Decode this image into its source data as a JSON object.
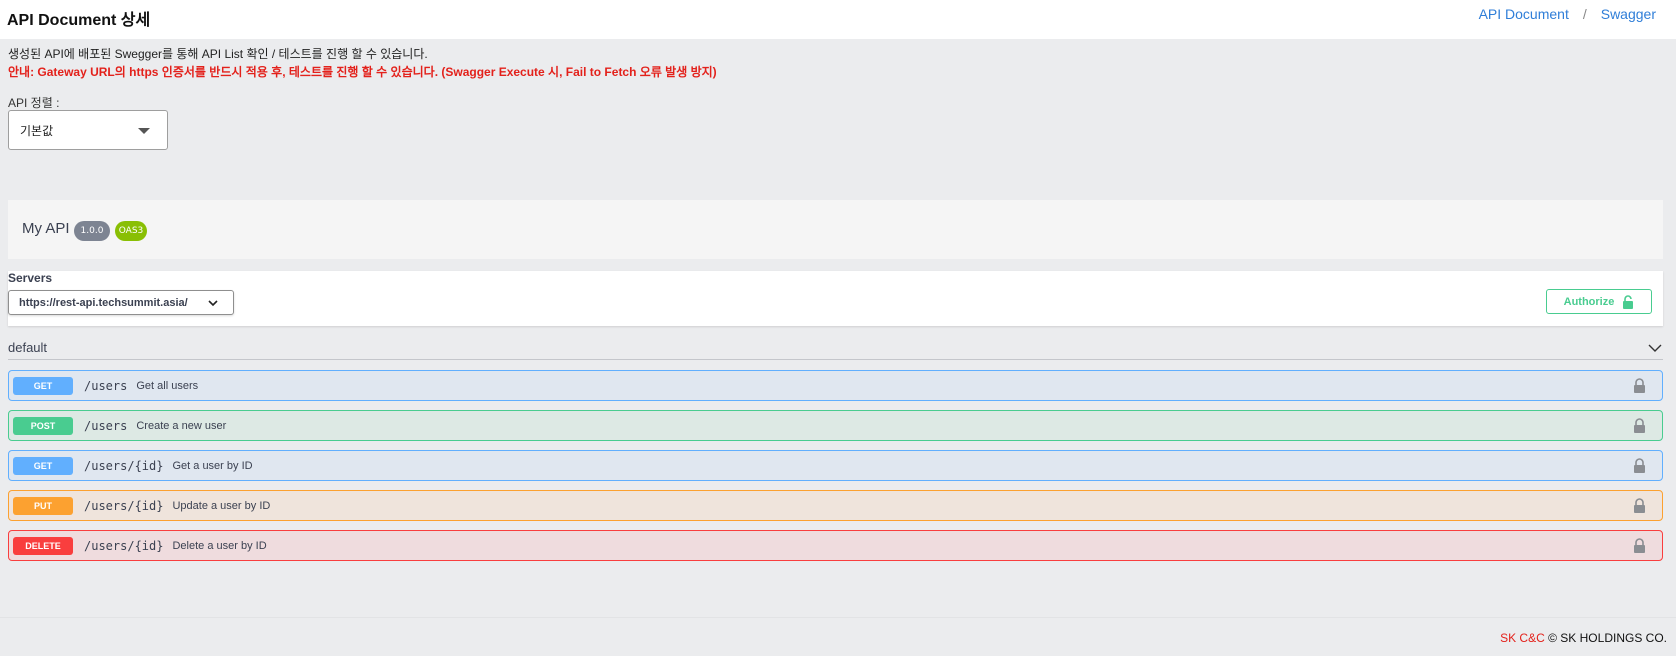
{
  "header": {
    "title": "API Document 상세",
    "breadcrumb": [
      "API Document",
      "Swagger"
    ],
    "separator": "/"
  },
  "intro": {
    "description": "생성된 API에 배포된 Swegger를 통해 API List 확인 / 테스트를 진행 할 수 있습니다.",
    "notice": "안내: Gateway URL의 https 인증서를 반드시 적용 후, 테스트를 진행 할 수 있습니다. (Swagger Execute 시, Fail to Fetch 오류 발생 방지)"
  },
  "sort": {
    "label": "API 정렬 :",
    "selected": "기본값"
  },
  "api_info": {
    "title": "My API",
    "version": "1.0.0",
    "oas": "OAS3"
  },
  "servers": {
    "label": "Servers",
    "selected": "https://rest-api.techsummit.asia/",
    "authorize_label": "Authorize"
  },
  "tag": {
    "name": "default"
  },
  "operations": [
    {
      "method": "GET",
      "path": "/users",
      "summary": "Get all users"
    },
    {
      "method": "POST",
      "path": "/users",
      "summary": "Create a new user"
    },
    {
      "method": "GET",
      "path": "/users/{id}",
      "summary": "Get a user by ID"
    },
    {
      "method": "PUT",
      "path": "/users/{id}",
      "summary": "Update a user by ID"
    },
    {
      "method": "DELETE",
      "path": "/users/{id}",
      "summary": "Delete a user by ID"
    }
  ],
  "footer": {
    "brand": "SK C&C",
    "copyright": "© SK HOLDINGS CO."
  },
  "colors": {
    "get": "#61affe",
    "post": "#49cc90",
    "put": "#fca130",
    "delete": "#f93e3e",
    "notice": "#e3211b",
    "link": "#2f7ed8"
  }
}
